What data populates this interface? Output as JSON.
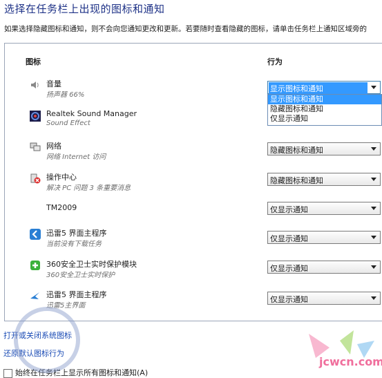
{
  "header": {
    "title": "选择在任务栏上出现的图标和通知",
    "description": "如果选择隐藏图标和通知，则不会向您通知更改和更新。若要随时查看隐藏的图标，请单击任务栏上通知区域旁的"
  },
  "columns": {
    "icon": "图标",
    "behavior": "行为"
  },
  "rows": [
    {
      "name": "音量",
      "sub": "扬声器 66%",
      "icon": "speaker-icon",
      "behavior": "显示图标和通知"
    },
    {
      "name": "Realtek Sound Manager",
      "sub": "Sound Effect",
      "icon": "realtek-icon",
      "behavior": ""
    },
    {
      "name": "网络",
      "sub": "网络 Internet 访问",
      "icon": "network-icon",
      "behavior": "隐藏图标和通知"
    },
    {
      "name": "操作中心",
      "sub": "解决 PC 问题  3 条重要消息",
      "icon": "action-center-icon",
      "behavior": "隐藏图标和通知"
    },
    {
      "name": "TM2009",
      "sub": "",
      "icon": "",
      "behavior": "仅显示通知"
    },
    {
      "name": "迅雷5 界面主程序",
      "sub": "当前没有下载任务",
      "icon": "xunlei-icon",
      "behavior": "仅显示通知"
    },
    {
      "name": "360安全卫士实时保护模块",
      "sub": "360安全卫士实时保护",
      "icon": "360-icon",
      "behavior": "仅显示通知"
    },
    {
      "name": "迅雷5 界面主程序",
      "sub": "迅雷5主界面",
      "icon": "xunlei-bird-icon",
      "behavior": "仅显示通知"
    }
  ],
  "dropdown_options": [
    "显示图标和通知",
    "隐藏图标和通知",
    "仅显示通知"
  ],
  "links": {
    "system_icons": "打开或关闭系统图标",
    "restore_defaults": "还原默认图标行为"
  },
  "checkbox_label": "始终在任务栏上显示所有图标和通知(A)",
  "watermark": {
    "site": "jcwcn.com"
  },
  "colors": {
    "accent": "#3399ff",
    "title": "#1e3287",
    "link": "#1a4bb5"
  }
}
